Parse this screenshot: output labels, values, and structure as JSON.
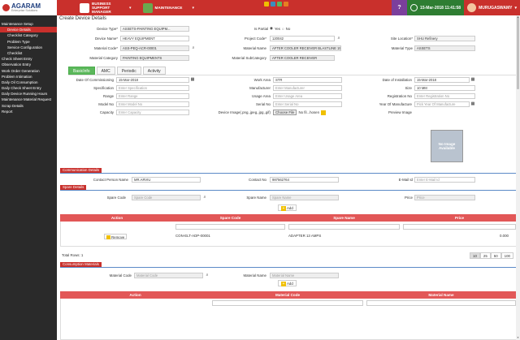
{
  "app": {
    "brand": "AGARAM",
    "brand_sub": "Enterprise Solutions"
  },
  "modules": {
    "business": "BUSINESS SUPPORT MANAGER",
    "maintenance": "MAINTENANCE"
  },
  "header": {
    "help": "?",
    "date": "15-Mar-2018 11:41:58",
    "user": "MURUGASWAMY"
  },
  "sidebar": {
    "items": [
      {
        "label": "Maintenance Setup"
      },
      {
        "label": "Device Details"
      },
      {
        "label": "Checklist Category"
      },
      {
        "label": "Problem Type"
      },
      {
        "label": "Service Configuration"
      },
      {
        "label": "Checklist"
      },
      {
        "label": "Check Sheet Entry"
      },
      {
        "label": "Observation Entry"
      },
      {
        "label": "Work Order Generation"
      },
      {
        "label": "Problem Intimation"
      },
      {
        "label": "Daily Oil Consumption"
      },
      {
        "label": "Daily Check Sheet Entry"
      },
      {
        "label": "Daily Device Running Hours"
      },
      {
        "label": "Maintenance Material Request"
      },
      {
        "label": "Scrap Details"
      },
      {
        "label": "Report"
      }
    ]
  },
  "page": {
    "title": "Create Device Details"
  },
  "form": {
    "device_type_label": "Device Type*",
    "device_type_value": "ASSETS-PAINTING EQUIPM...",
    "is_partial_label": "Is Partial",
    "yes": "Yes",
    "no": "No",
    "device_name_label": "Device Name*",
    "device_name_value": "HEAVY EQUIPMENT",
    "project_code_label": "Project Code*",
    "project_code_value": "120042",
    "site_location_label": "Site Location*",
    "site_location_value": "SHU Refinery",
    "material_code_label": "Material Code*",
    "material_code_value": "ASS-PEQ-ACR-00001",
    "material_name_label": "Material Name",
    "material_name_value": "AFTER COOLER RECEIVER BLASTLINE 150V",
    "material_type_label": "Material Type",
    "material_type_value": "ASSETS",
    "material_category_label": "Material Category",
    "material_category_value": "PAINTING EQUIPMENTS",
    "material_subcategory_label": "Material SubCategory",
    "material_subcategory_value": "AFTER COOLER RECEIVER"
  },
  "tabs": [
    {
      "label": "BasicInfo"
    },
    {
      "label": "AMC"
    },
    {
      "label": "Periodic"
    },
    {
      "label": "Activity"
    }
  ],
  "basic": {
    "doc_label": "Date Of Commissioning",
    "doc_value": "15-Mar-2018",
    "work_area_label": "Work Area",
    "work_area_value": "STR",
    "doi_label": "Date of Installation",
    "doi_value": "15-Mar-2018",
    "spec_label": "Specification",
    "spec_placeholder": "Enter Specification",
    "manuf_label": "Manufacturer",
    "manuf_placeholder": "Enter Manufacturer",
    "size_label": "Size",
    "size_value": "10 MM",
    "range_label": "Range",
    "range_placeholder": "Enter Range",
    "usage_label": "Usage Area",
    "usage_placeholder": "Enter Usage Area",
    "reg_label": "Registration No",
    "reg_placeholder": "Enter Registration No",
    "model_label": "Model No",
    "model_placeholder": "Enter Model No",
    "serial_label": "Serial No",
    "serial_placeholder": "Enter Serial No",
    "yom_label": "Year Of Manufacture",
    "yom_placeholder": "Pick Year Of Manufacture",
    "cap_label": "Capacity",
    "cap_placeholder": "Enter Capacity",
    "img_label": "Device Image(.png,.jpeg,.jpg,.gif)",
    "choose_file": "Choose File",
    "no_file": "No fil...hosen",
    "preview_label": "Preview Image",
    "no_image": "No Image Available"
  },
  "comm": {
    "section": "Communication Details",
    "cp_label": "Contact Person Name",
    "cp_value": "MR.ARVIU",
    "cn_label": "Contact No",
    "cn_value": "987562764",
    "email_label": "E-Mail Id",
    "email_placeholder": "Enter E-Mail Id"
  },
  "spare": {
    "section": "Spare Details",
    "code_label": "Spare Code",
    "code_placeholder": "Spare Code",
    "name_label": "Spare Name",
    "name_placeholder": "Spare Name",
    "price_label": "Price",
    "price_placeholder": "Price",
    "add": "Add",
    "columns": [
      "Action",
      "Spare Code",
      "Spare Name",
      "Price"
    ],
    "rows": [
      {
        "action": "Remove",
        "code": "CON-ELT-ADP-00001",
        "name": "ADAPTER 13 AMPS",
        "price": "0.000"
      }
    ],
    "total": "Total Rows: 1",
    "pages": [
      "10",
      "25",
      "50",
      "100"
    ]
  },
  "consumption": {
    "section": "Consumption Materials",
    "code_label": "Material Code",
    "code_placeholder": "Material Code",
    "name_label": "Material Name",
    "name_placeholder": "Material Name",
    "add": "Add",
    "columns": [
      "Action",
      "Material Code",
      "Material Name"
    ]
  }
}
